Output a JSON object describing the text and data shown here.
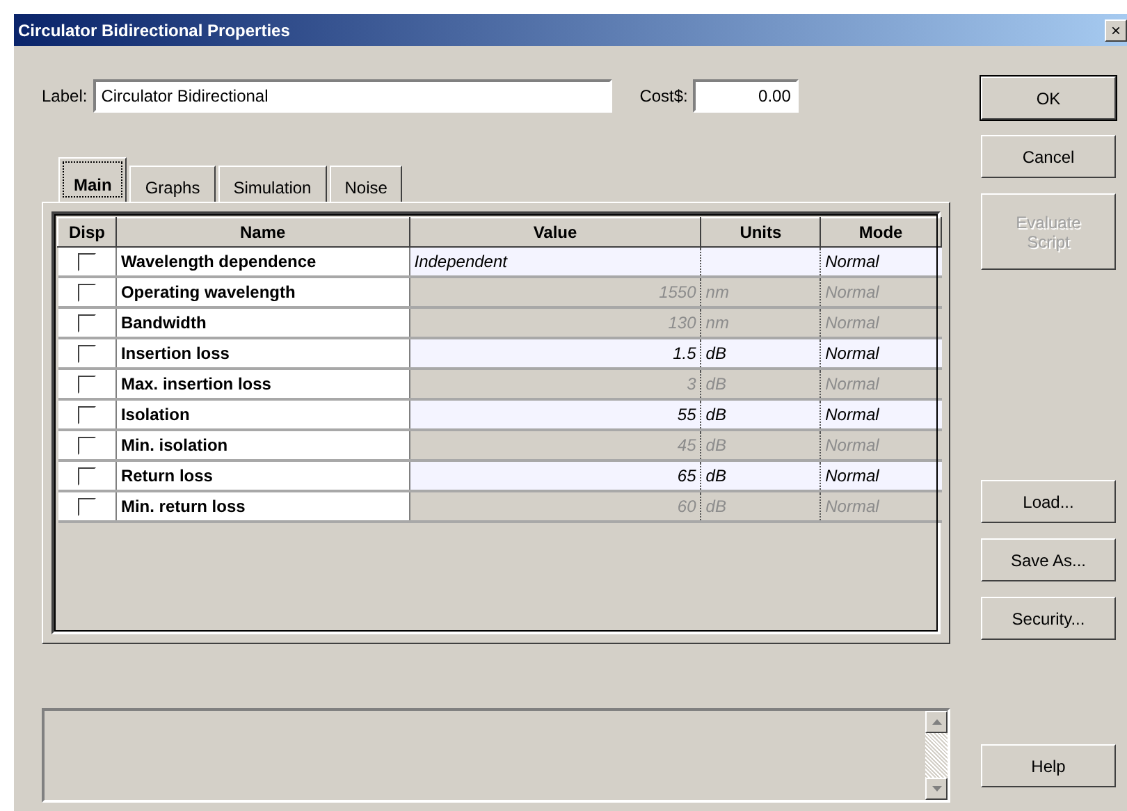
{
  "window": {
    "title": "Circulator Bidirectional Properties",
    "close": "×"
  },
  "label_field": {
    "label": "Label:",
    "value": "Circulator Bidirectional"
  },
  "cost_field": {
    "label": "Cost$:",
    "value": "0.00"
  },
  "tabs": [
    {
      "label": "Main",
      "selected": true
    },
    {
      "label": "Graphs",
      "selected": false
    },
    {
      "label": "Simulation",
      "selected": false
    },
    {
      "label": "Noise",
      "selected": false
    }
  ],
  "table": {
    "columns": [
      "Disp",
      "Name",
      "Value",
      "Units",
      "Mode"
    ],
    "rows": [
      {
        "checked": false,
        "name": "Wavelength dependence",
        "value": "Independent",
        "kind": "choice",
        "mode": "Normal",
        "disabled": false
      },
      {
        "checked": false,
        "name": "Operating wavelength",
        "value": "1550",
        "units": "nm",
        "kind": "number",
        "mode": "Normal",
        "disabled": true
      },
      {
        "checked": false,
        "name": "Bandwidth",
        "value": "130",
        "units": "nm",
        "kind": "number",
        "mode": "Normal",
        "disabled": true
      },
      {
        "checked": false,
        "name": "Insertion loss",
        "value": "1.5",
        "units": "dB",
        "kind": "number",
        "mode": "Normal",
        "disabled": false
      },
      {
        "checked": false,
        "name": "Max. insertion loss",
        "value": "3",
        "units": "dB",
        "kind": "number",
        "mode": "Normal",
        "disabled": true
      },
      {
        "checked": false,
        "name": "Isolation",
        "value": "55",
        "units": "dB",
        "kind": "number",
        "mode": "Normal",
        "disabled": false
      },
      {
        "checked": false,
        "name": "Min. isolation",
        "value": "45",
        "units": "dB",
        "kind": "number",
        "mode": "Normal",
        "disabled": true
      },
      {
        "checked": false,
        "name": "Return loss",
        "value": "65",
        "units": "dB",
        "kind": "number",
        "mode": "Normal",
        "disabled": false
      },
      {
        "checked": false,
        "name": "Min. return loss",
        "value": "60",
        "units": "dB",
        "kind": "number",
        "mode": "Normal",
        "disabled": true
      }
    ]
  },
  "top_buttons": [
    {
      "label": "OK",
      "disabled": false,
      "default": true
    },
    {
      "label": "Cancel",
      "disabled": false,
      "default": false
    },
    {
      "label": "Evaluate Script",
      "disabled": true,
      "default": false
    }
  ],
  "file_buttons": [
    {
      "label": "Load..."
    },
    {
      "label": "Save As..."
    },
    {
      "label": "Security..."
    }
  ],
  "help_button": {
    "label": "Help"
  }
}
